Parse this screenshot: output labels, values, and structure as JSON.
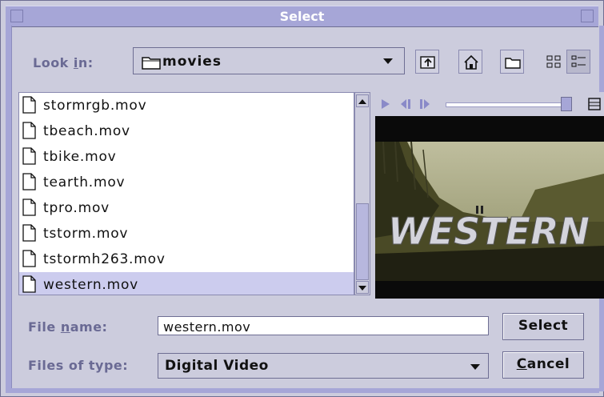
{
  "window": {
    "title": "Select"
  },
  "look_in": {
    "label": "Look in:",
    "mnemonic": "i",
    "value": "movies",
    "folder_icon": "folder-icon"
  },
  "toolbar": {
    "icons": [
      "up-folder-icon",
      "home-icon",
      "new-folder-icon",
      "list-view-icon",
      "details-view-icon"
    ]
  },
  "files": [
    {
      "name": "stormrgb.mov",
      "selected": false
    },
    {
      "name": "tbeach.mov",
      "selected": false
    },
    {
      "name": "tbike.mov",
      "selected": false
    },
    {
      "name": "tearth.mov",
      "selected": false
    },
    {
      "name": "tpro.mov",
      "selected": false
    },
    {
      "name": "tstorm.mov",
      "selected": false
    },
    {
      "name": "tstormh263.mov",
      "selected": false
    },
    {
      "name": "western.mov",
      "selected": true
    }
  ],
  "preview": {
    "overlay_text": "WESTERN",
    "controls": [
      "play-icon",
      "step-back-icon",
      "step-forward-icon",
      "volume-slider",
      "filmstrip-icon"
    ]
  },
  "file_name": {
    "label_prefix": "File ",
    "label_mnemonic": "n",
    "label_suffix": "ame:",
    "value": "western.mov"
  },
  "file_type": {
    "label": "Files of type:",
    "value": "Digital Video"
  },
  "buttons": {
    "select": "Select",
    "cancel_mnemonic": "C",
    "cancel_rest": "ancel"
  },
  "colors": {
    "frame": "#a6a6d7",
    "panel": "#ccccdd",
    "selection": "#ccccee"
  }
}
